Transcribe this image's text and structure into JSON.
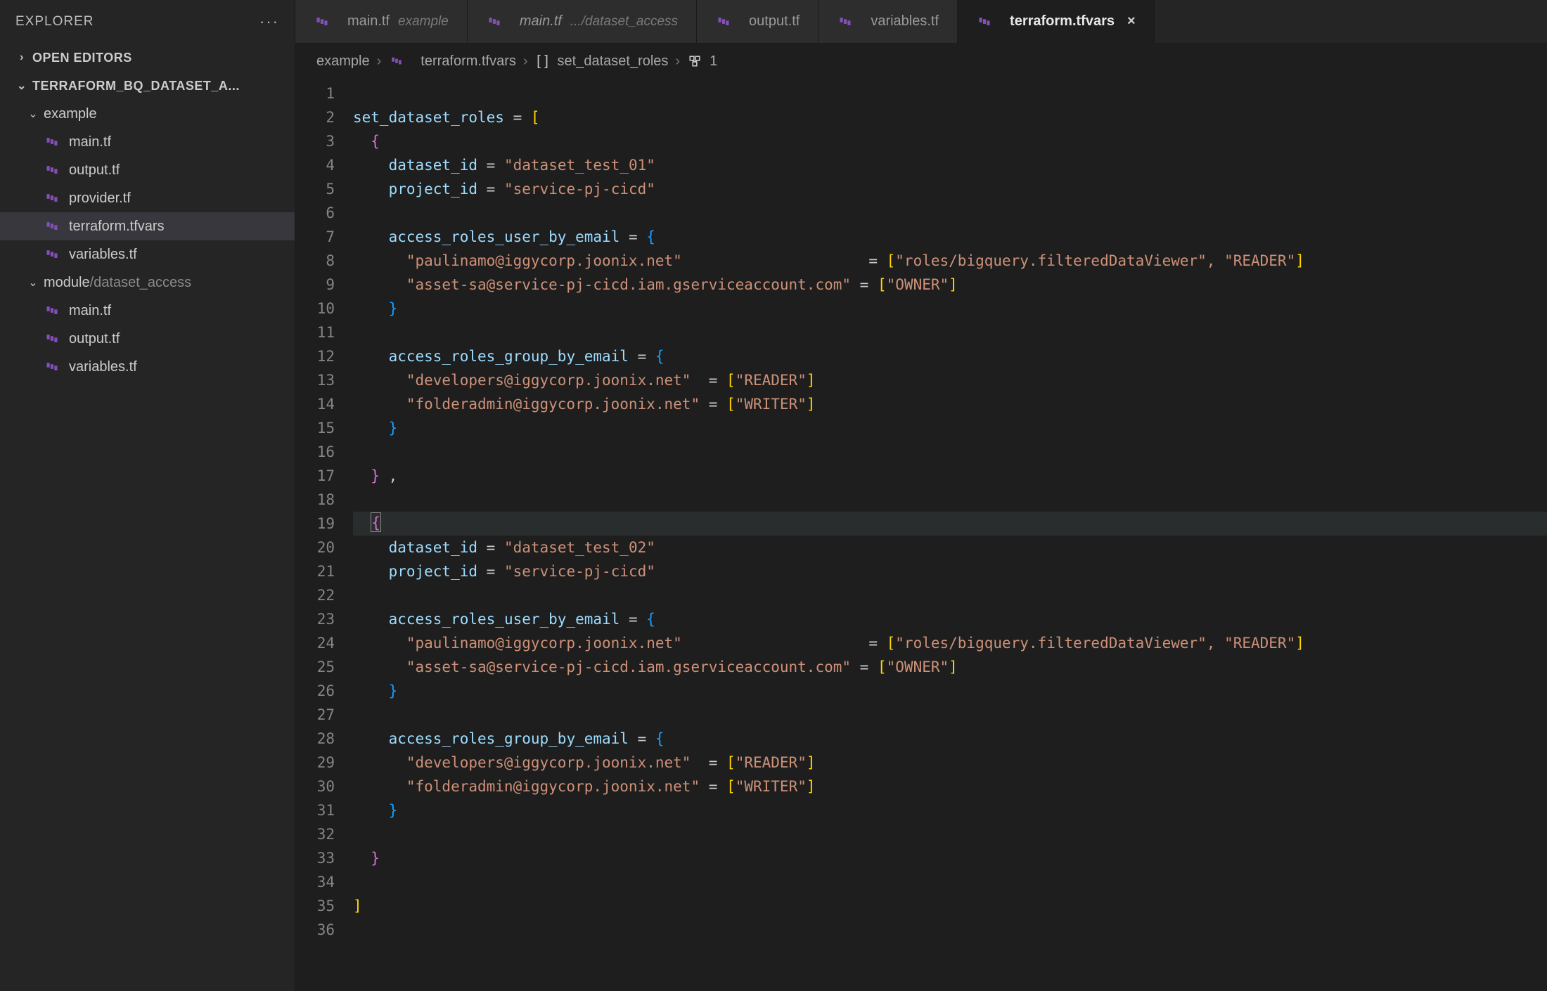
{
  "sidebar": {
    "title": "EXPLORER",
    "open_editors_label": "OPEN EDITORS",
    "root_label": "TERRAFORM_BQ_DATASET_A...",
    "folder_example": "example",
    "folder_module_prefix": "module",
    "folder_module_path_sep": "/",
    "folder_module_name": "dataset_access",
    "files_example": [
      "main.tf",
      "output.tf",
      "provider.tf",
      "terraform.tfvars",
      "variables.tf"
    ],
    "files_module": [
      "main.tf",
      "output.tf",
      "variables.tf"
    ]
  },
  "tabs": [
    {
      "name": "main.tf",
      "hint": "example",
      "italic": false,
      "active": false,
      "close": false
    },
    {
      "name": "main.tf",
      "hint": ".../dataset_access",
      "italic": true,
      "active": false,
      "close": false
    },
    {
      "name": "output.tf",
      "hint": "",
      "italic": false,
      "active": false,
      "close": false
    },
    {
      "name": "variables.tf",
      "hint": "",
      "italic": false,
      "active": false,
      "close": false
    },
    {
      "name": "terraform.tfvars",
      "hint": "",
      "italic": false,
      "active": true,
      "close": true
    }
  ],
  "breadcrumbs": {
    "seg1": "example",
    "seg2": "terraform.tfvars",
    "seg3": "set_dataset_roles",
    "seg4": "1"
  },
  "code": {
    "var_name": "set_dataset_roles",
    "block1": {
      "dataset_id_key": "dataset_id",
      "dataset_id_val": "\"dataset_test_01\"",
      "project_id_key": "project_id",
      "project_id_val": "\"service-pj-cicd\"",
      "user_key": "access_roles_user_by_email",
      "user_row1_k": "\"paulinamo@iggycorp.joonix.net\"",
      "user_row1_v": "\"roles/bigquery.filteredDataViewer\", \"READER\"",
      "user_row2_k": "\"asset-sa@service-pj-cicd.iam.gserviceaccount.com\"",
      "user_row2_v": "\"OWNER\"",
      "group_key": "access_roles_group_by_email",
      "group_row1_k": "\"developers@iggycorp.joonix.net\"",
      "group_row1_v": "\"READER\"",
      "group_row2_k": "\"folderadmin@iggycorp.joonix.net\"",
      "group_row2_v": "\"WRITER\""
    },
    "block2": {
      "dataset_id_key": "dataset_id",
      "dataset_id_val": "\"dataset_test_02\"",
      "project_id_key": "project_id",
      "project_id_val": "\"service-pj-cicd\"",
      "user_key": "access_roles_user_by_email",
      "user_row1_k": "\"paulinamo@iggycorp.joonix.net\"",
      "user_row1_v": "\"roles/bigquery.filteredDataViewer\", \"READER\"",
      "user_row2_k": "\"asset-sa@service-pj-cicd.iam.gserviceaccount.com\"",
      "user_row2_v": "\"OWNER\"",
      "group_key": "access_roles_group_by_email",
      "group_row1_k": "\"developers@iggycorp.joonix.net\"",
      "group_row1_v": "\"READER\"",
      "group_row2_k": "\"folderadmin@iggycorp.joonix.net\"",
      "group_row2_v": "\"WRITER\""
    }
  },
  "line_count": 36
}
